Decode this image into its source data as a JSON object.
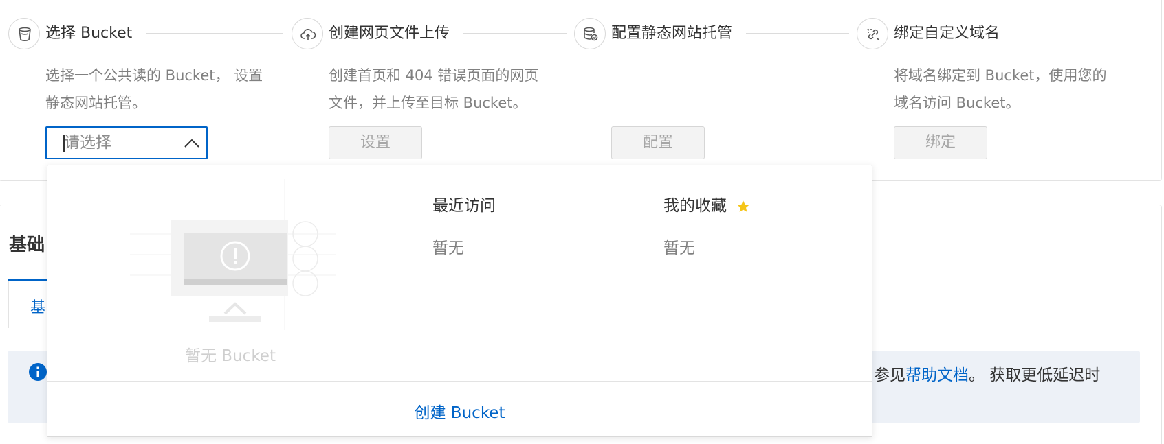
{
  "steps": [
    {
      "icon": "bucket-icon",
      "title": "选择 Bucket",
      "desc_lines": [
        "选择一个公共读的 Bucket， 设置",
        "静态网站托管。"
      ],
      "control": {
        "type": "select",
        "placeholder": "请选择"
      }
    },
    {
      "icon": "cloud-upload-icon",
      "title": "创建网页文件上传",
      "desc_lines": [
        "创建首页和 404 错误页面的网页",
        "文件，并上传至目标 Bucket。"
      ],
      "control": {
        "type": "button",
        "label": "设置",
        "disabled": true
      }
    },
    {
      "icon": "database-check-icon",
      "title": "配置静态网站托管",
      "desc_lines": [],
      "control": {
        "type": "button",
        "label": "配置",
        "disabled": true
      }
    },
    {
      "icon": "link-icon",
      "title": "绑定自定义域名",
      "desc_lines": [
        "将域名绑定到 Bucket，使用您的",
        "域名访问 Bucket。"
      ],
      "control": {
        "type": "button",
        "label": "绑定",
        "disabled": true
      }
    }
  ],
  "section": {
    "title": "基础",
    "tab_label": "基",
    "notice_prefix": "参见",
    "notice_link": "帮助文档",
    "notice_suffix": "。 获取更低延迟时"
  },
  "dropdown": {
    "empty_text": "暂无 Bucket",
    "recent": {
      "title": "最近访问",
      "empty": "暂无"
    },
    "favorites": {
      "title": "我的收藏",
      "empty": "暂无"
    },
    "create_link": "创建 Bucket"
  },
  "colors": {
    "primary": "#0064c8",
    "star": "#f5c518",
    "notice_bg": "#edf1f7",
    "disabled_bg": "#f3f3f3"
  }
}
